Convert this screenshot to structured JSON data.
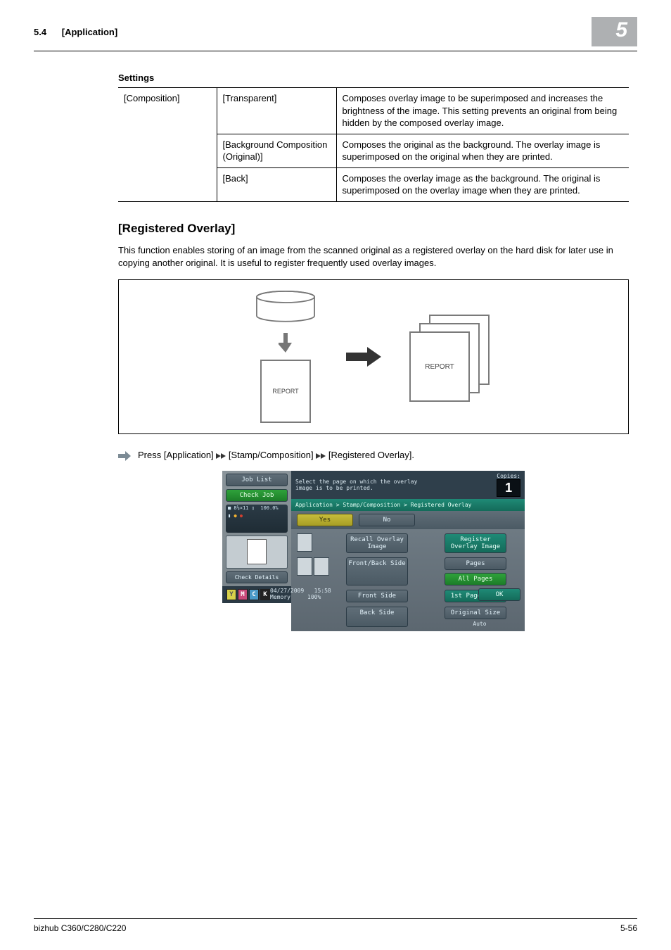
{
  "header": {
    "section_num": "5.4",
    "section_title": "[Application]",
    "chapter_num": "5"
  },
  "table": {
    "caption": "Settings",
    "col1": "[Composition]",
    "rows": [
      {
        "opt": "[Transparent]",
        "desc": "Composes overlay image to be superimposed and increases the brightness of the image. This setting prevents an original from being hidden by the composed overlay image."
      },
      {
        "opt": "[Background Composition (Original)]",
        "desc": "Composes the original as the background. The overlay image is superimposed on the original when they are printed."
      },
      {
        "opt": "[Back]",
        "desc": "Composes the overlay image as the background. The original is superimposed on the overlay image when they are printed."
      }
    ]
  },
  "section": {
    "title": "[Registered Overlay]",
    "body": "This function enables storing of an image from the scanned original as a registered overlay on the hard disk for later use in copying another original. It is useful to register frequently used overlay images.",
    "diagram_label1": "REPORT",
    "diagram_label2": "REPORT"
  },
  "nav": {
    "prefix": "Press ",
    "seg1": "[Application]",
    "seg2": "[Stamp/Composition]",
    "seg3": "[Registered Overlay]."
  },
  "screenshot": {
    "job_list": "Job List",
    "check_job": "Check Job",
    "check_details": "Check Details",
    "status_zoom": "100.0%",
    "prompt": "Select the page on which the overlay image is to be printed.",
    "copies_label": "Copies:",
    "copies_value": "1",
    "breadcrumb": "Application > Stamp/Composition > Registered Overlay",
    "yes": "Yes",
    "no": "No",
    "recall": "Recall Overlay Image",
    "register": "Register Overlay Image",
    "front_back": "Front/Back Side",
    "pages": "Pages",
    "all_pages": "All Pages",
    "front_side": "Front Side",
    "first_page": "1st Page Only",
    "back_side": "Back Side",
    "orig_size_lbl": "Original Size",
    "orig_size_val": "Auto",
    "date": "04/27/2009",
    "time": "15:58",
    "mem_label": "Memory",
    "mem_val": "100%",
    "ok": "OK",
    "toner": {
      "y": "Y",
      "m": "M",
      "c": "C",
      "k": "K"
    }
  },
  "footer": {
    "model": "bizhub C360/C280/C220",
    "page": "5-56"
  }
}
